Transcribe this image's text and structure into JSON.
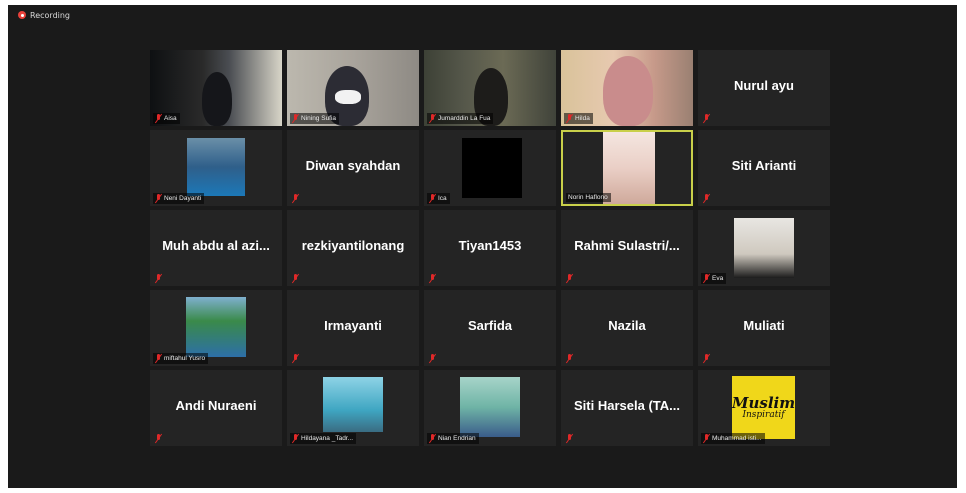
{
  "status": {
    "recording_label": "Recording"
  },
  "colors": {
    "active_speaker_border": "#c9d04a",
    "muted_mic": "#e02828",
    "recording_dot": "#e8403a"
  },
  "participants": [
    {
      "name": "Aisa",
      "video": true,
      "muted": true
    },
    {
      "name": "Nining Sufia",
      "video": true,
      "muted": true
    },
    {
      "name": "Jumarddin La Fua",
      "video": true,
      "muted": true
    },
    {
      "name": "Hilda",
      "video": true,
      "muted": true
    },
    {
      "name": "Nurul ayu",
      "video": false,
      "muted": true
    },
    {
      "name": "Neni Dayanti",
      "video": "photo",
      "muted": true
    },
    {
      "name": "Diwan syahdan",
      "video": false,
      "muted": true
    },
    {
      "name": "Ica",
      "video": "photo",
      "muted": true
    },
    {
      "name": "Norin Haflono",
      "video": "photo",
      "muted": false,
      "active": true
    },
    {
      "name": "Siti Arianti",
      "video": false,
      "muted": true
    },
    {
      "name": "Muh abdu al azi...",
      "video": false,
      "muted": true
    },
    {
      "name": "rezkiyantilonang",
      "video": false,
      "muted": true
    },
    {
      "name": "Tiyan1453",
      "video": false,
      "muted": true
    },
    {
      "name": "Rahmi Sulastri/...",
      "video": false,
      "muted": true
    },
    {
      "name": "Eva",
      "video": "photo",
      "muted": true
    },
    {
      "name": "miftahul Yusro",
      "video": "photo",
      "muted": true
    },
    {
      "name": "Irmayanti",
      "video": false,
      "muted": true
    },
    {
      "name": "Sarfida",
      "video": false,
      "muted": true
    },
    {
      "name": "Nazila",
      "video": false,
      "muted": true
    },
    {
      "name": "Muliati",
      "video": false,
      "muted": true
    },
    {
      "name": "Andi Nuraeni",
      "video": false,
      "muted": true
    },
    {
      "name": "Hildayana _Tadr...",
      "video": "photo",
      "muted": true
    },
    {
      "name": "Nian Endrian",
      "video": "photo",
      "muted": true
    },
    {
      "name": "Siti Harsela (TA...",
      "video": false,
      "muted": true
    },
    {
      "name": "Muhammad isti...",
      "video": "photo",
      "muted": true,
      "logo_text": [
        "Muslim",
        "Inspiratif"
      ]
    }
  ]
}
